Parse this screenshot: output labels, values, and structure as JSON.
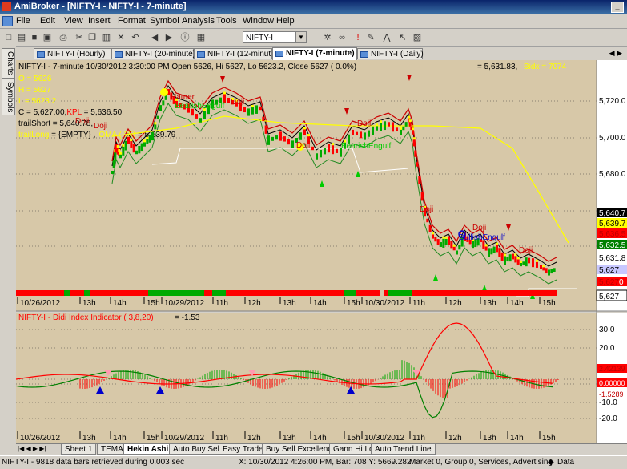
{
  "window": {
    "title": "AmiBroker - [NIFTY-I - NIFTY-I - 7-minute]",
    "minimize_glyph": "_"
  },
  "menu": [
    "File",
    "Edit",
    "View",
    "Insert",
    "Format",
    "Symbol",
    "Analysis",
    "Tools",
    "Window",
    "Help"
  ],
  "toolbar": {
    "symbol_value": "NIFTY-I",
    "icons": [
      "new-icon",
      "open-icon",
      "save-icon",
      "save-all-icon",
      "print-icon",
      "cut-icon",
      "copy-icon",
      "paste-icon",
      "delete-icon",
      "undo-icon",
      "back-icon",
      "forward-icon",
      "info-icon",
      "chart-icon"
    ]
  },
  "side_tabs": [
    "Charts",
    "Symbols"
  ],
  "chart_tabs": [
    {
      "label": "NIFTY-I (Hourly)",
      "active": false
    },
    {
      "label": "NIFTY-I (20-minute)",
      "active": false
    },
    {
      "label": "NIFTY-I (12-minute",
      "active": false
    },
    {
      "label": "NIFTY-I (7-minute)",
      "active": true
    },
    {
      "label": "NIFTY-I (Daily)",
      "active": false
    }
  ],
  "price_pane": {
    "header": "NIFTY-I - 7-minute 10/30/2012 3:30:00 PM Open 5626, Hi 5627, Lo 5623.2, Close 5627  ( 0.0%)",
    "right_header_value": "= 5,631.83,",
    "right_header_bidx": "Bidx = 7074",
    "ohlc_lines": [
      "O = 5626",
      "H = 5627",
      "L = 5623.2"
    ],
    "close_line_prefix": "C = 5,627.00,",
    "close_line_kpl": "KPL",
    "close_line_suffix": " = 5,636.50,",
    "trail_short": "trailShort = 5,640.78,",
    "trail_long_prefix": "trailLong",
    "trail_long_suffix": " = {EMPTY} ,",
    "oma_label": "OMA ( 35)",
    "oma_value": " = 5,639.79",
    "y_ticks": [
      "5,720.0",
      "5,700.0",
      "5,680.0"
    ],
    "price_tags": [
      {
        "label": "5,640.7",
        "bg": "#000000",
        "fg": "#ffffff"
      },
      {
        "label": "5,639.7",
        "bg": "#ffff00",
        "fg": "#000000"
      },
      {
        "label": "5,636.5",
        "bg": "#ff0000",
        "fg": "#c00000"
      },
      {
        "label": "5,632.5",
        "bg": "#008000",
        "fg": "#ffffff"
      },
      {
        "label": "5,631.8",
        "bg": "#ffffff",
        "fg": "#000000"
      },
      {
        "label": "5,627",
        "bg": "#c8c8ff",
        "fg": "#000000"
      },
      {
        "label": "5,627",
        "bg": "#ff0000",
        "fg": "#c00000",
        "suffix": "0"
      },
      {
        "label": "5,627",
        "bg": "#ffffff",
        "fg": "#000000"
      }
    ],
    "pattern_labels": [
      "BearishEngulf",
      "Hamer",
      "Doji",
      "Doji",
      "Doji",
      "Doji",
      "BearishEngulf",
      "Doji",
      "Doji",
      "Doji",
      "BullishEngulf",
      "Doji"
    ],
    "x_labels": [
      "10/26/2012",
      "13h",
      "14h",
      "15h",
      "10/29/2012",
      "11h",
      "12h",
      "13h",
      "14h",
      "15h",
      "10/30/2012",
      "11h",
      "12h",
      "13h",
      "14h",
      "15h"
    ]
  },
  "indicator_pane": {
    "title": "NIFTY-I - Didi Index Indicator ( 3,8,20)",
    "value": " = -1.53",
    "y_ticks": [
      "30.0",
      "20.0",
      "-10.0",
      "-20.0"
    ],
    "value_tags": [
      {
        "label": "2.42139",
        "bg": "#ff0000",
        "fg": "#c00000"
      },
      {
        "label": "0.00000",
        "bg": "#ff0000",
        "fg": "#ffffff"
      },
      {
        "label": "-1.5289",
        "bg": "#ff0000",
        "fg": "#c00000"
      }
    ],
    "x_labels": [
      "10/26/2012",
      "13h",
      "14h",
      "15h",
      "10/29/2012",
      "11h",
      "12h",
      "13h",
      "14h",
      "15h",
      "10/30/2012",
      "11h",
      "12h",
      "13h",
      "14h",
      "15h"
    ]
  },
  "sheets": [
    {
      "label": "Sheet 1",
      "active": false
    },
    {
      "label": "TEMA",
      "active": false
    },
    {
      "label": "Hekin Ashi",
      "active": true
    },
    {
      "label": "Auto Buy Sell",
      "active": false
    },
    {
      "label": "Easy Trade",
      "active": false
    },
    {
      "label": "Buy Sell Excellence",
      "active": false
    },
    {
      "label": "Gann Hi Lo",
      "active": false
    },
    {
      "label": "Auto Trend Line",
      "active": false
    }
  ],
  "status_bar": {
    "left": "NIFTY-I - 9818 data bars retrieved during 0.003 sec",
    "coords": "X: 10/30/2012 4:26:00 PM, Bar: 708 Y: 5669.282",
    "market": "Market 0, Group 0, Services, Advertising",
    "data": "Data"
  },
  "colors": {
    "chart_bg": "#d7c8a8",
    "up": "#008000",
    "down": "#ff0000",
    "oma": "#ffff00",
    "trail": "#000000"
  }
}
